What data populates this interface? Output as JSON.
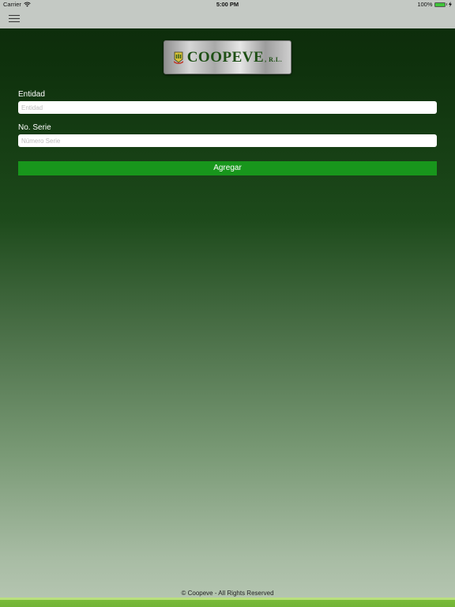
{
  "status_bar": {
    "carrier": "Carrier",
    "time": "5:00 PM",
    "battery_percent": "100%",
    "battery_level": 1.0,
    "battery_color": "#3fc43a",
    "wifi_icon": "wifi-icon",
    "charging_icon": "charging-bolt-icon"
  },
  "nav_bar": {
    "menu_icon": "hamburger-menu-icon"
  },
  "logo": {
    "name": "COOPEVE",
    "suffix": ", R.L.",
    "emblem_icon": "coopeve-emblem-icon",
    "text_color": "#1e4f15"
  },
  "form": {
    "entidad_label": "Entidad",
    "entidad_placeholder": "Entidad",
    "entidad_value": "",
    "serie_label": "No. Serie",
    "serie_placeholder": "Número Serie",
    "serie_value": "",
    "add_button_label": "Agregar",
    "add_button_color": "#18961c"
  },
  "footer": {
    "copyright": "© Coopeve - All Rights Reserved"
  }
}
